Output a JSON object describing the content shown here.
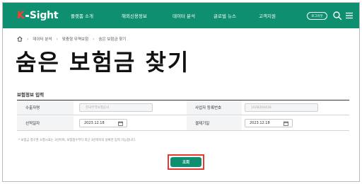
{
  "header": {
    "logo_k": "K",
    "logo_rest": "Sight",
    "nav": [
      "플랫폼 소개",
      "해외신용정보",
      "데이터 분석",
      "글로벌 뉴스",
      "고객지원"
    ],
    "login_label": "로그아웃",
    "bg_color": "#0e8f6f",
    "logo_accent": "#ff3b30"
  },
  "breadcrumb": [
    "데이터 분석",
    "맞춤형 무역보험",
    "숨은 보험금 찾기"
  ],
  "page_title": "숨은 보험금 찾기",
  "section_title": "보험정보 입력",
  "form": {
    "row1": {
      "label_left": "수출자명",
      "value_left": "한국무역보험공사",
      "label_right": "사업자 등록번호",
      "value_right": "1028204416"
    },
    "row2": {
      "label_left": "선적일자",
      "date_left": "2023.12.18",
      "label_right": "결제기일",
      "date_right": "2023.12.18"
    }
  },
  "notice": "* 보험금 청구권 소멸시효는 3년이며, 보험접수부터 최근 3년까지의 날짜만 입력 가능합니다.",
  "search_button": "조회",
  "highlight_color": "#e53935"
}
